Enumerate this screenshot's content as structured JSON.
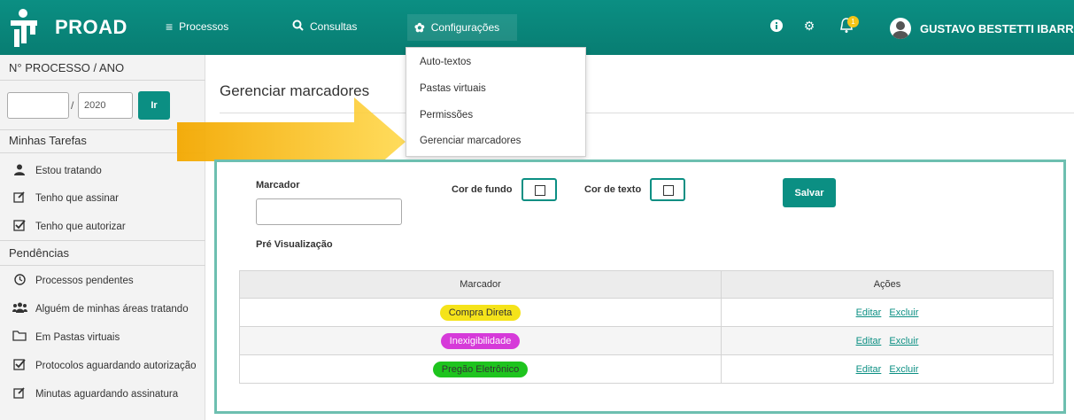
{
  "app": {
    "name": "PROAD"
  },
  "nav": [
    {
      "label": "Processos",
      "icon": "menu-icon"
    },
    {
      "label": "Consultas",
      "icon": "search-icon"
    },
    {
      "label": "Configurações",
      "icon": "gear-icon"
    }
  ],
  "header": {
    "user_name": "GUSTAVO BESTETTI IBARRA",
    "notification_count": "1"
  },
  "dropdown": {
    "items": [
      "Auto-textos",
      "Pastas virtuais",
      "Permissões",
      "Gerenciar marcadores"
    ]
  },
  "sidebar": {
    "process_title": "N° PROCESSO / ANO",
    "process_number": "",
    "process_year": "2020",
    "go_label": "Ir",
    "tasks_title": "Minhas Tarefas",
    "tasks": [
      {
        "label": "Estou tratando",
        "icon": "user-icon"
      },
      {
        "label": "Tenho que assinar",
        "icon": "edit-icon"
      },
      {
        "label": "Tenho que autorizar",
        "icon": "checkbox-icon"
      }
    ],
    "pending_title": "Pendências",
    "pending": [
      {
        "label": "Processos pendentes",
        "icon": "clock-icon"
      },
      {
        "label": "Alguém de minhas áreas tratando",
        "icon": "users-icon"
      },
      {
        "label": "Em Pastas virtuais",
        "icon": "folder-icon"
      },
      {
        "label": "Protocolos aguardando autorização",
        "icon": "checkbox-icon"
      },
      {
        "label": "Minutas aguardando assinatura",
        "icon": "edit-icon"
      }
    ]
  },
  "main": {
    "title": "Gerenciar marcadores",
    "form": {
      "marcador_label": "Marcador",
      "marcador_value": "",
      "cor_fundo_label": "Cor de fundo",
      "cor_texto_label": "Cor de texto",
      "salvar_label": "Salvar",
      "preview_label": "Pré Visualização"
    },
    "table": {
      "headers": [
        "Marcador",
        "Ações"
      ],
      "rows": [
        {
          "marcador": "Compra Direta",
          "bg": "#f5e31a",
          "fg": "#333333",
          "edit": "Editar",
          "delete": "Excluir"
        },
        {
          "marcador": "Inexigibilidade",
          "bg": "#d63ad9",
          "fg": "#ffffff",
          "edit": "Editar",
          "delete": "Excluir"
        },
        {
          "marcador": "Pregão Eletrônico",
          "bg": "#1ec41e",
          "fg": "#333333",
          "edit": "Editar",
          "delete": "Excluir"
        }
      ]
    }
  },
  "colors": {
    "brand": "#0b8f83",
    "panel_border": "#6dbfb0",
    "arrow": "#f5b800"
  }
}
